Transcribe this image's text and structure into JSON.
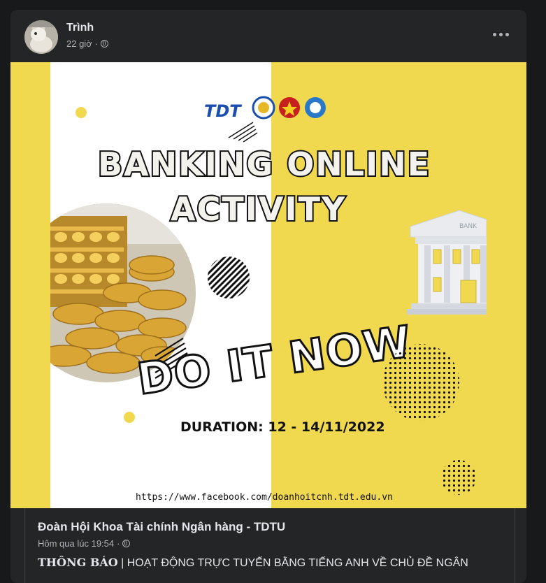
{
  "post": {
    "author": "Trình",
    "time": "22 giờ",
    "separator": "·",
    "privacy_icon": "globe-icon",
    "more_icon": "more-horizontal-icon"
  },
  "poster": {
    "logos": [
      "TDT",
      "finance-bank-logo",
      "youth-union-logo",
      "student-association-logo"
    ],
    "title_line1": "BANKING ONLINE",
    "title_line2": "ACTIVITY",
    "cta": "DO IT NOW",
    "duration": "DURATION: 12 - 14/11/2022",
    "url": "https://www.facebook.com/doanhoitcnh.tdt.edu.vn",
    "bank_sign": "BANK"
  },
  "shared": {
    "page_name": "Đoàn Hội Khoa Tài chính Ngân hàng - TDTU",
    "time": "Hôm qua lúc 19:54",
    "separator": "·",
    "text_bold": "THÔNG BÁO",
    "text_rest": " | HOẠT ĐỘNG TRỰC TUYẾN BẰNG TIẾNG ANH VỀ CHỦ ĐỀ NGÂN"
  },
  "colors": {
    "background": "#18191a",
    "card": "#242526",
    "poster_yellow": "#f0d84f",
    "poster_white": "#ffffff",
    "text_primary": "#e4e6eb",
    "text_secondary": "#b0b3b8"
  }
}
